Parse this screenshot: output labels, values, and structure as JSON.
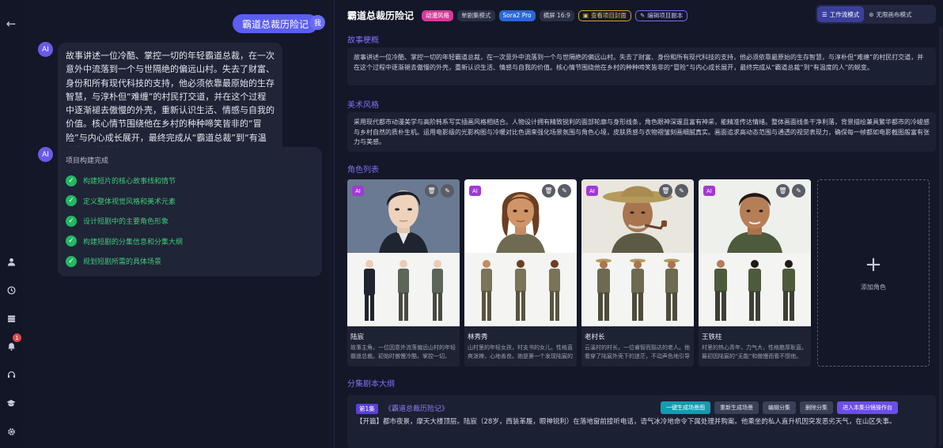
{
  "rail": {
    "notification_count": "1"
  },
  "chat": {
    "user_message": "霸道总裁历险记",
    "user_avatar": "我",
    "ai_avatar": "AI",
    "ai_message": "故事讲述一位冷酷、掌控一切的年轻霸道总裁，在一次意外中流落到一个与世隔绝的偏远山村。失去了财富、身份和所有现代科技的支持，他必须依靠最原始的生存智慧，与淳朴但“难缠”的村民打交道，并在这个过程中逐渐褪去傲慢的外壳，重新认识生活、情感与自我的价值。核心情节围绕他在乡村的种种啼笑皆非的“冒险”与内心成长展开，最终完成从“霸道总裁”到“有温度的人”的蜕变。",
    "task_title": "项目构建完成",
    "tasks": [
      "构建短片的核心故事线和情节",
      "定义整体视觉风格和美术元素",
      "设计短剧中的主要角色形象",
      "构建短剧的分集信息和分集大纲",
      "规划短剧所需的具体场景"
    ]
  },
  "header": {
    "title": "霸道总裁历险记",
    "tags": [
      "动漫风格",
      "单剧集模式",
      "Sora2 Pro",
      "横屏 16:9"
    ],
    "view_cover": "查看项目封面",
    "edit_script": "编辑项目副本",
    "mode_workflow": "工作流模式",
    "mode_canvas": "无限画布模式"
  },
  "synopsis": {
    "heading": "故事梗概",
    "text": "故事讲述一位冷酷、掌控一切的年轻霸道总裁，在一次意外中流落到一个与世隔绝的偏远山村。失去了财富、身份和所有现代科技的支持，他必须依靠最原始的生存智慧，与淳朴但“难缠”的村民打交道，并在这个过程中逐渐褪去傲慢的外壳，重新认识生活、情感与自我的价值。核心情节围绕他在乡村的种种啼笑皆非的“冒险”与内心成长展开，最终完成从“霸道总裁”到“有温度的人”的蜕变。"
  },
  "art_style": {
    "heading": "美术风格",
    "text": "采用现代都市动漫美学与高阶韩系写实插画风格相结合。人物设计拥有精致锐利的面部轮廓与身形线条，角色眼神深邃且富有神采，能精准传达情绪。整体画面线条干净利落，背景描绘兼具繁华都市的冷峻感与乡村自然的质朴生机。运用电影级的光影构图与冷暖对比色调来强化场景氛围与角色心境，皮肤质感与衣物褶皱刻画细腻真实。画面追求高动态范围与通透的视觉表现力，确保每一帧都如电影截图般富有张力与美感。"
  },
  "characters": {
    "heading": "角色列表",
    "ai_label": "AI",
    "items": [
      {
        "name": "陆宸",
        "desc": "故事主角，一位因意外流落偏远山村的年轻霸道总裁。初始时傲慢冷酷，掌控一切。"
      },
      {
        "name": "林秀秀",
        "desc": "山村里的年轻女孩，村支书的女儿。性格直爽泼辣，心地善良。她是第一个发现陆宸的人。"
      },
      {
        "name": "老村长",
        "desc": "云溪村的村长，一位睿智而豁达的老人。他看穿了陆宸外壳下的迷茫，不动声色地引导他。"
      },
      {
        "name": "王铁柱",
        "desc": "村里的热心青年，力气大，性格憨厚耿直。最初因陆宸的“无能”和傲慢而看不惯他。"
      }
    ],
    "add_label": "添加角色"
  },
  "episodes": {
    "heading": "分集剧本大纲",
    "items": [
      {
        "number": "第1集",
        "title": "《霸道总裁历险记》",
        "buttons": [
          "一键生成场景图",
          "重新生成场景",
          "编辑分集",
          "删除分集",
          "进入本集分镜操作台"
        ],
        "text": "【开篇】都市夜景，摩天大楼顶层。陆宸（28岁，西装革履，眼神锐利）在落地窗前接听电话，语气冰冷地命令下属处理并购案。他乘坐的私人直升机因突发恶劣天气，在山区失事。"
      }
    ]
  },
  "colors": {
    "accent": "#7f6ef5",
    "user_bubble": "#5b5ef0",
    "success": "#22b862"
  }
}
